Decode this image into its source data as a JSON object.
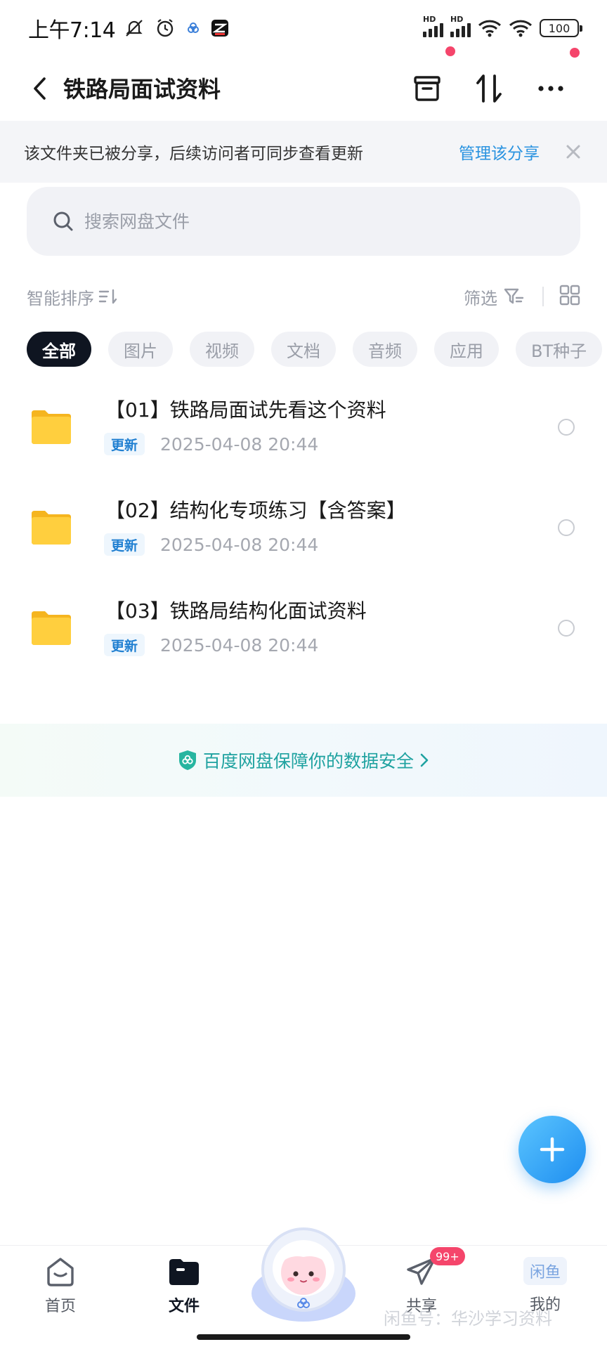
{
  "status_bar": {
    "time": "上午7:14",
    "battery": "100"
  },
  "header": {
    "title": "铁路局面试资料"
  },
  "share_banner": {
    "text": "该文件夹已被分享，后续访问者可同步查看更新",
    "manage_label": "管理该分享"
  },
  "search": {
    "placeholder": "搜索网盘文件"
  },
  "sort": {
    "label": "智能排序",
    "filter_label": "筛选"
  },
  "chips": [
    "全部",
    "图片",
    "视频",
    "文档",
    "音频",
    "应用",
    "BT种子"
  ],
  "files": [
    {
      "name": "【01】铁路局面试先看这个资料",
      "badge": "更新",
      "date": "2025-04-08  20:44"
    },
    {
      "name": "【02】结构化专项练习【含答案】",
      "badge": "更新",
      "date": "2025-04-08  20:44"
    },
    {
      "name": "【03】铁路局结构化面试资料",
      "badge": "更新",
      "date": "2025-04-08  20:44"
    }
  ],
  "security_banner": {
    "text": "百度网盘保障你的数据安全"
  },
  "bottom_nav": {
    "home": "首页",
    "files": "文件",
    "share": "共享",
    "share_badge": "99+",
    "me": "我的",
    "watermark": "闲鱼号：华沙学习资料"
  },
  "colors": {
    "accent": "#2a93e0",
    "chip_active_bg": "#0f1521",
    "red_dot": "#f5456b",
    "security_text": "#1fa2a0",
    "folder": "#ffc934"
  }
}
